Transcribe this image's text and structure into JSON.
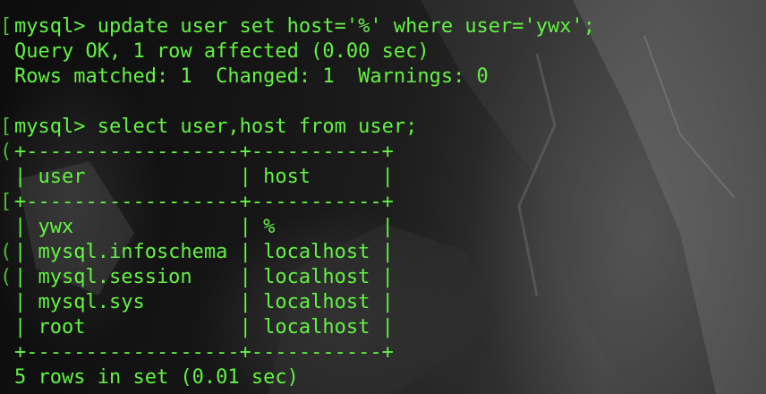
{
  "terminal": {
    "lines": [
      {
        "gutter": "[",
        "text": "mysql> update user set host='%' where user='ywx';"
      },
      {
        "gutter": "",
        "text": "Query OK, 1 row affected (0.00 sec)"
      },
      {
        "gutter": "",
        "text": "Rows matched: 1  Changed: 1  Warnings: 0"
      },
      {
        "gutter": "",
        "text": ""
      },
      {
        "gutter": "[",
        "text": "mysql> select user,host from user;"
      },
      {
        "gutter": "(",
        "text": "+------------------+-----------+"
      },
      {
        "gutter": "",
        "text": "| user             | host      |"
      },
      {
        "gutter": "[",
        "text": "+------------------+-----------+"
      },
      {
        "gutter": "",
        "text": "| ywx              | %         |"
      },
      {
        "gutter": "(",
        "text": "| mysql.infoschema | localhost |"
      },
      {
        "gutter": "(",
        "text": "| mysql.session    | localhost |"
      },
      {
        "gutter": "",
        "text": "| mysql.sys        | localhost |"
      },
      {
        "gutter": "",
        "text": "| root             | localhost |"
      },
      {
        "gutter": "",
        "text": "+------------------+-----------+"
      },
      {
        "gutter": "",
        "text": "5 rows in set (0.01 sec)"
      }
    ]
  },
  "colors": {
    "text": "#63f243",
    "background": "#151515"
  }
}
